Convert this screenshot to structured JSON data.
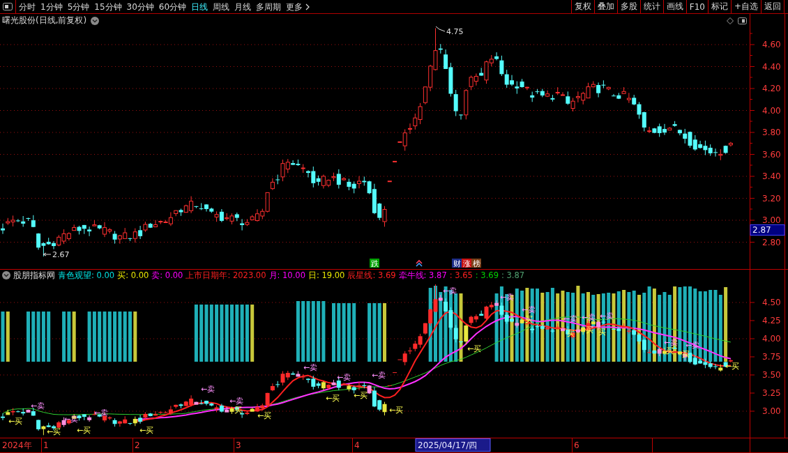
{
  "toolbar": {
    "periods": [
      {
        "label": "分时",
        "selected": false
      },
      {
        "label": "1分钟",
        "selected": false
      },
      {
        "label": "5分钟",
        "selected": false
      },
      {
        "label": "15分钟",
        "selected": false
      },
      {
        "label": "30分钟",
        "selected": false
      },
      {
        "label": "60分钟",
        "selected": false
      },
      {
        "label": "日线",
        "selected": true
      },
      {
        "label": "周线",
        "selected": false
      },
      {
        "label": "月线",
        "selected": false
      },
      {
        "label": "多周期",
        "selected": false
      }
    ],
    "more": "更多",
    "actions": [
      "复权",
      "叠加",
      "多股",
      "统计",
      "画线",
      "F10",
      "标记",
      "+自选",
      "返回"
    ]
  },
  "main_chart": {
    "title": "曙光股份(日线,前复权)",
    "price_axis": [
      "4.60",
      "4.40",
      "4.20",
      "4.00",
      "3.80",
      "3.60",
      "3.40",
      "3.20",
      "3.00",
      "2.80"
    ],
    "current_price": "2.87",
    "high_label": "4.75",
    "low_label": "2.67",
    "events": [
      {
        "kind": "drop",
        "label": "跌"
      },
      {
        "kind": "report",
        "label": "财"
      },
      {
        "kind": "limit",
        "label": "涨"
      },
      {
        "kind": "board",
        "label": "榜"
      }
    ]
  },
  "indicator": {
    "name": "股朋指标网",
    "legend": [
      {
        "text": "青色观望: 0.00",
        "color": "#00e0e0"
      },
      {
        "text": "买: 0.00",
        "color": "#e8e800"
      },
      {
        "text": "卖: 0.00",
        "color": "#ff00ff"
      },
      {
        "text": "上市日期年: 2023.00",
        "color": "#ff2020"
      },
      {
        "text": "月: 10.00",
        "color": "#ff00ff"
      },
      {
        "text": "日: 19.00",
        "color": "#e8e800"
      },
      {
        "text": "辰星线: 3.69",
        "color": "#ff2020"
      },
      {
        "text": "牵牛线: 3.87",
        "color": "#ff00ff"
      },
      {
        "text": ": 3.65",
        "color": "#ff2020"
      },
      {
        "text": ": 3.69",
        "color": "#00d000"
      },
      {
        "text": ": 3.87",
        "color": "#50a070"
      }
    ],
    "value_axis": [
      "4.50",
      "4.25",
      "4.00",
      "3.75",
      "3.50",
      "3.25",
      "3.00"
    ],
    "signals": [
      {
        "kind": "buy",
        "text": "←买"
      },
      {
        "kind": "sell",
        "text": "←卖"
      },
      {
        "kind": "buy",
        "text": "←买"
      },
      {
        "kind": "sell",
        "text": "←卖"
      },
      {
        "kind": "buy",
        "text": "←买"
      },
      {
        "kind": "sell",
        "text": "←卖"
      },
      {
        "kind": "buy",
        "text": "←买"
      },
      {
        "kind": "sell",
        "text": "←卖"
      },
      {
        "kind": "sell",
        "text": "←卖"
      },
      {
        "kind": "buy",
        "text": "买"
      },
      {
        "kind": "buy",
        "text": "←买"
      },
      {
        "kind": "sell",
        "text": "←卖"
      },
      {
        "kind": "buy",
        "text": "←买"
      },
      {
        "kind": "sell",
        "text": "←卖"
      },
      {
        "kind": "buy",
        "text": "←买"
      },
      {
        "kind": "sell",
        "text": "←卖"
      },
      {
        "kind": "buy",
        "text": "←买"
      },
      {
        "kind": "sell",
        "text": "←卖"
      },
      {
        "kind": "buy",
        "text": "←买"
      },
      {
        "kind": "sell",
        "text": "←卖"
      },
      {
        "kind": "sell",
        "text": "←卖"
      },
      {
        "kind": "buy",
        "text": "买"
      },
      {
        "kind": "sell",
        "text": "←卖"
      },
      {
        "kind": "buy",
        "text": "买"
      },
      {
        "kind": "sell",
        "text": "←卖"
      },
      {
        "kind": "buy",
        "text": "买"
      },
      {
        "kind": "sell",
        "text": "←卖"
      },
      {
        "kind": "buy",
        "text": "买"
      },
      {
        "kind": "sell",
        "text": "←卖"
      },
      {
        "kind": "buy",
        "text": "买"
      },
      {
        "kind": "sell",
        "text": "←卖"
      },
      {
        "kind": "buy",
        "text": "买"
      },
      {
        "kind": "buy",
        "text": "←买"
      }
    ]
  },
  "time_axis": {
    "labels": [
      "2024年",
      "1",
      "2",
      "3",
      "4",
      "6"
    ],
    "cursor_date": "2025/04/17/四"
  }
}
